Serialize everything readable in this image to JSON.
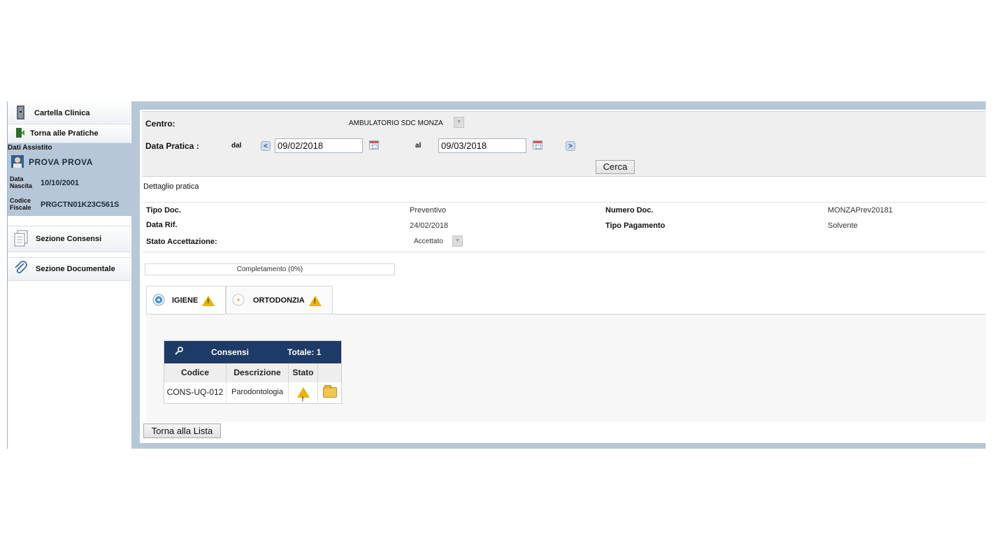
{
  "sidebar": {
    "cartella_clinica": "Cartella Clinica",
    "torna_pratiche": "Torna alle Pratiche",
    "dati_assistito_title": "Dati Assistito",
    "patient_name": "PROVA  PROVA",
    "data_nascita_label_1": "Data",
    "data_nascita_label_2": "Nascita",
    "data_nascita": "10/10/2001",
    "codice_fiscale_label_1": "Codice",
    "codice_fiscale_label_2": "Fiscale",
    "codice_fiscale": "PRGCTN01K23C561S",
    "sezione_consensi": "Sezione Consensi",
    "sezione_documentale": "Sezione Documentale"
  },
  "search": {
    "centro_label": "Centro:",
    "centro_value": "AMBULATORIO SDC MONZA",
    "data_pratica_label": "Data Pratica :",
    "dal_label": "dal",
    "dal_value": "09/02/2018",
    "al_label": "al",
    "al_value": "09/03/2018",
    "cerca_button": "Cerca"
  },
  "detail": {
    "title": "Dettaglio pratica",
    "tipo_doc_label": "Tipo Doc.",
    "tipo_doc_value": "Preventivo",
    "numero_doc_label": "Numero Doc.",
    "numero_doc_value": "MONZAPrev20181",
    "data_rif_label": "Data Rif.",
    "data_rif_value": "24/02/2018",
    "tipo_pagamento_label": "Tipo Pagamento",
    "tipo_pagamento_value": "Solvente",
    "stato_accettazione_label": "Stato Accettazione:",
    "stato_accettazione_value": "Accettato"
  },
  "progress": {
    "label": "Completamento (0%)",
    "percent": 0
  },
  "tabs": [
    {
      "label": "IGIENE",
      "active": true
    },
    {
      "label": "ORTODONZIA",
      "active": false
    }
  ],
  "consensi": {
    "title": "Consensi",
    "totale": "Totale: 1",
    "columns": [
      "Codice",
      "Descrizione",
      "Stato"
    ],
    "rows": [
      {
        "codice": "CONS-UQ-012",
        "descrizione": "Parodontologia"
      }
    ]
  },
  "footer": {
    "torna_lista": "Torna alla Lista"
  },
  "colors": {
    "frame": "#b7c7d8",
    "grid_header": "#1e3a66",
    "warning": "#e8b400"
  }
}
